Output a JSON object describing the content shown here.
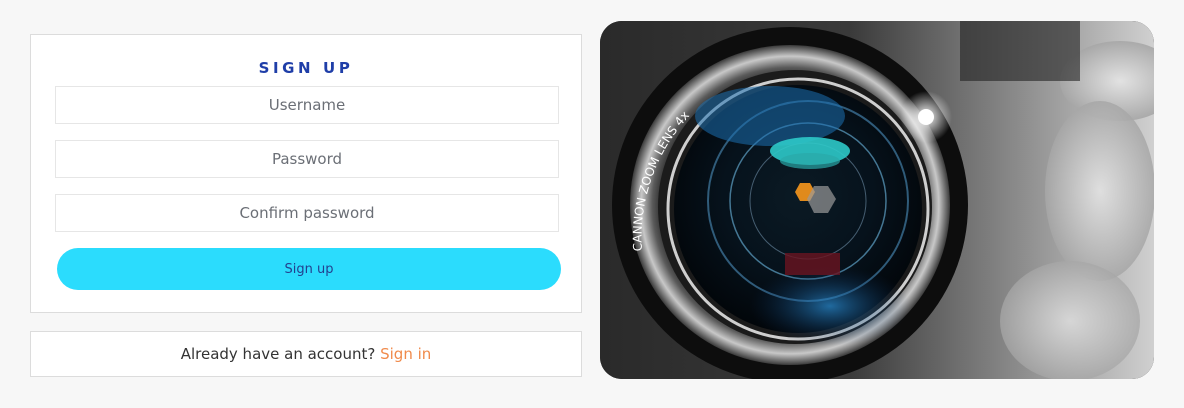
{
  "signup": {
    "title": "SIGN UP",
    "username_placeholder": "Username",
    "password_placeholder": "Password",
    "confirm_placeholder": "Confirm password",
    "submit_label": "Sign up"
  },
  "signin_prompt": {
    "text": "Already have an account?",
    "link_label": "Sign in"
  },
  "hero_image": {
    "lens_text": "CANNON ZOOM LENS 4x"
  },
  "colors": {
    "title": "#1f3ea8",
    "button_bg": "#2bdcfd",
    "button_text": "#23418f",
    "link": "#f08a4b",
    "page_bg": "#f7f7f7"
  }
}
